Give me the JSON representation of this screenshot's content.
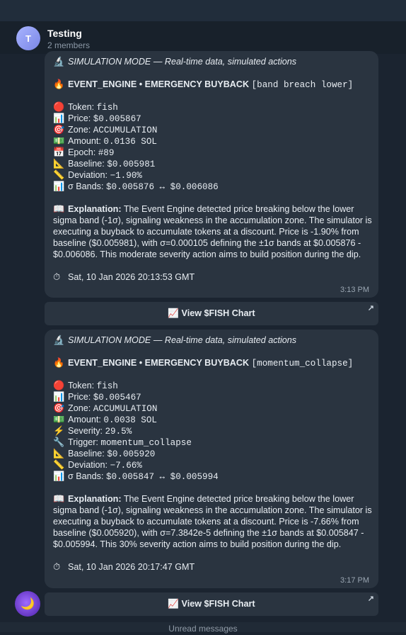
{
  "chat": {
    "avatar_letter": "T",
    "title": "Testing",
    "subtitle": "2 members"
  },
  "messages": [
    {
      "sim_icon": "🔬",
      "sim_text": "SIMULATION MODE — Real-time data, simulated actions",
      "event_icon": "🔥",
      "event_prefix": "EVENT_ENGINE • EMERGENCY BUYBACK ",
      "event_tag": "[band breach lower]",
      "fields": [
        {
          "icon": "🔴",
          "label": "Token: ",
          "value": "fish"
        },
        {
          "icon": "📊",
          "label": "Price: ",
          "value": "$0.005867"
        },
        {
          "icon": "🎯",
          "label": "Zone: ",
          "value": "ACCUMULATION"
        },
        {
          "icon": "💵",
          "label": "Amount: ",
          "value": "0.0136 SOL"
        },
        {
          "icon": "📅",
          "label": "Epoch: ",
          "value": "#89"
        },
        {
          "icon": "📐",
          "label": "Baseline: ",
          "value": "$0.005981"
        },
        {
          "icon": "📏",
          "label": "Deviation: ",
          "value": "−1.90%"
        },
        {
          "icon": "📊",
          "label": "σ Bands: ",
          "value": "$0.005876 ↔ $0.006086"
        }
      ],
      "explanation_icon": "📖",
      "explanation_label": "Explanation:",
      "explanation_text": " The Event Engine detected price breaking below the lower sigma band (-1σ), signaling weakness in the accumulation zone. The simulator is executing a buyback to accumulate tokens at a discount. Price is -1.90% from baseline ($0.005981), with σ=0.000105 defining the ±1σ bands at $0.005876 - $0.006086. This moderate severity action aims to build position during the dip.",
      "clock_icon": "⏱",
      "date": "Sat, 10 Jan 2026 20:13:53 GMT",
      "time": "3:13 PM",
      "button_label": "📈 View $FISH Chart",
      "button_arrow": "↗"
    },
    {
      "sim_icon": "🔬",
      "sim_text": "SIMULATION MODE — Real-time data, simulated actions",
      "event_icon": "🔥",
      "event_prefix": "EVENT_ENGINE • EMERGENCY BUYBACK ",
      "event_tag": "[momentum_collapse]",
      "fields": [
        {
          "icon": "🔴",
          "label": "Token: ",
          "value": "fish"
        },
        {
          "icon": "📊",
          "label": "Price: ",
          "value": "$0.005467"
        },
        {
          "icon": "🎯",
          "label": "Zone: ",
          "value": "ACCUMULATION"
        },
        {
          "icon": "💵",
          "label": "Amount: ",
          "value": "0.0038 SOL"
        },
        {
          "icon": "⚡",
          "label": "Severity: ",
          "value": "29.5%"
        },
        {
          "icon": "🔧",
          "label": "Trigger: ",
          "value": "momentum_collapse"
        },
        {
          "icon": "📐",
          "label": "Baseline: ",
          "value": "$0.005920"
        },
        {
          "icon": "📏",
          "label": "Deviation: ",
          "value": "−7.66%"
        },
        {
          "icon": "📊",
          "label": "σ Bands: ",
          "value": "$0.005847 ↔ $0.005994"
        }
      ],
      "explanation_icon": "📖",
      "explanation_label": "Explanation:",
      "explanation_text": " The Event Engine detected price breaking below the lower sigma band (-1σ), signaling weakness in the accumulation zone. The simulator is executing a buyback to accumulate tokens at a discount. Price is -7.66% from baseline ($0.005920), with σ=7.3842e-5 defining the ±1σ bands at $0.005847 - $0.005994. This 30% severity action aims to build position during the dip.",
      "clock_icon": "⏱",
      "date": "Sat, 10 Jan 2026 20:17:47 GMT",
      "time": "3:17 PM",
      "button_label": "📈 View $FISH Chart",
      "button_arrow": "↗"
    }
  ],
  "sender_avatar_icon": "🌙",
  "unread_label": "Unread messages"
}
